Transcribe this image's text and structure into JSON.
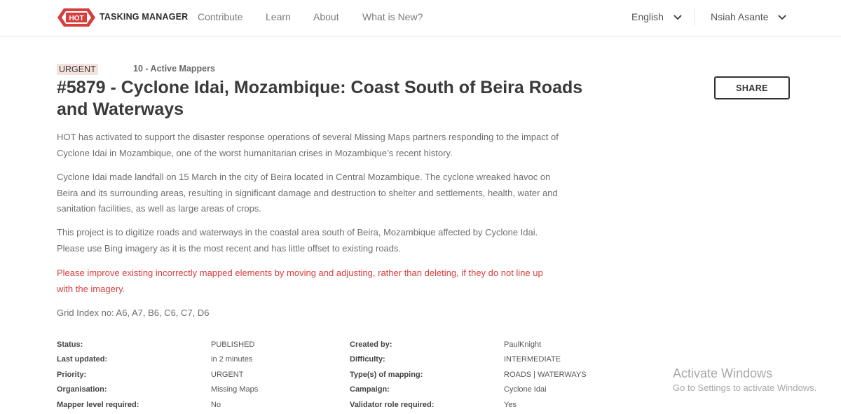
{
  "header": {
    "logo_text": "HOT",
    "brand": "TASKING MANAGER",
    "nav": [
      "Contribute",
      "Learn",
      "About",
      "What is New?"
    ],
    "language": "English",
    "user": "Nsiah Asante"
  },
  "project": {
    "priority_badge": "URGENT",
    "active_mappers": "10 - Active Mappers",
    "title": "#5879 - Cyclone Idai, Mozambique: Coast South of Beira Roads and Waterways",
    "paragraphs": [
      "HOT has activated to support the disaster response operations of several Missing Maps partners responding to the impact of Cyclone Idai in Mozambique, one of the worst humanitarian crises in Mozambique’s recent history.",
      "Cyclone Idai made landfall on 15 March in the city of Beira located in Central Mozambique. The cyclone wreaked havoc on Beira and its surrounding areas, resulting in significant damage and destruction to shelter and settlements, health, water and sanitation facilities, as well as large areas of crops.",
      "This project is to digitize roads and waterways in the coastal area south of Beira, Mozambique affected by Cyclone Idai. Please use Bing imagery as it is the most recent and has little offset to existing roads.",
      "Please improve existing incorrectly mapped elements by moving and adjusting, rather than deleting, if they do not line up with the imagery.",
      "Grid Index no: A6, A7, B6, C6, C7, D6"
    ],
    "share_label": "SHARE"
  },
  "details": {
    "left": [
      {
        "label": "Status:",
        "value": "PUBLISHED"
      },
      {
        "label": "Last updated:",
        "value": "in 2 minutes"
      },
      {
        "label": "Priority:",
        "value": "URGENT"
      },
      {
        "label": "Organisation:",
        "value": "Missing Maps"
      },
      {
        "label": "Mapper level required:",
        "value": "No"
      }
    ],
    "right": [
      {
        "label": "Created by:",
        "value": "PaulKnight"
      },
      {
        "label": "Difficulty:",
        "value": "INTERMEDIATE"
      },
      {
        "label": "Type(s) of mapping:",
        "value": "ROADS | WATERWAYS"
      },
      {
        "label": "Campaign:",
        "value": "Cyclone Idai"
      },
      {
        "label": "Validator role required:",
        "value": "Yes"
      }
    ]
  },
  "watermark": {
    "line1": "Activate Windows",
    "line2": "Go to Settings to activate Windows."
  },
  "colors": {
    "brand_red": "#d73f3f",
    "badge_bg": "#f5e1de"
  }
}
